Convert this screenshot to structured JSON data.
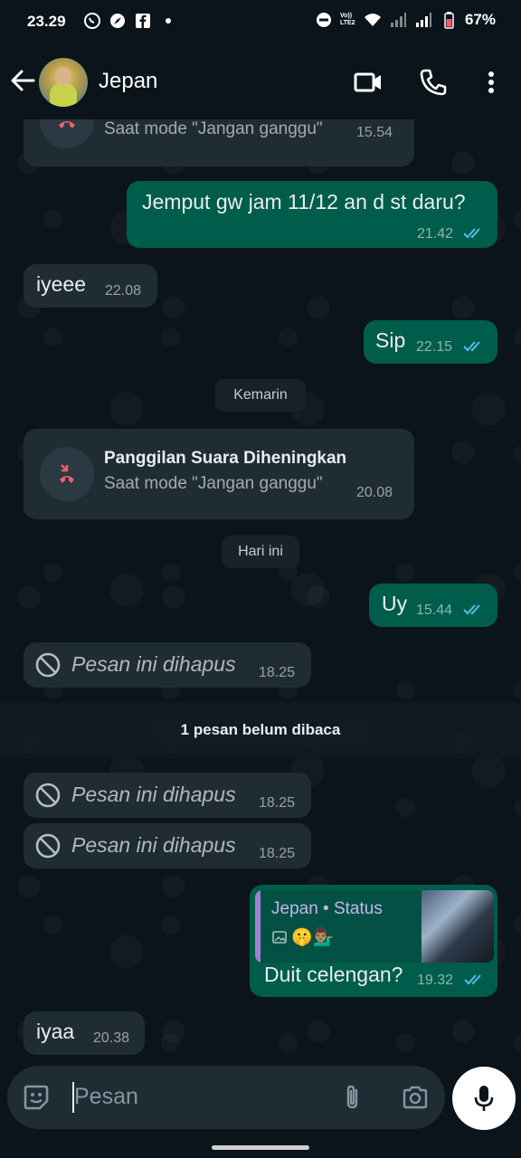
{
  "status_bar": {
    "time": "23.29",
    "network_label": "Vo)) LTE2",
    "battery": "67%"
  },
  "header": {
    "contact_name": "Jepan",
    "icons": [
      "back-arrow-icon",
      "video-call-icon",
      "voice-call-icon",
      "more-vert-icon"
    ]
  },
  "chat": {
    "top_call": {
      "subtitle": "Saat mode \"Jangan ganggu\"",
      "time": "15.54"
    },
    "messages": [
      {
        "dir": "out",
        "text": "Jemput gw jam 11/12 an d st daru?",
        "time": "21.42",
        "status": "read"
      },
      {
        "dir": "in",
        "text": "iyeee",
        "time": "22.08"
      },
      {
        "dir": "out",
        "text": "Sip",
        "time": "22.15",
        "status": "read"
      }
    ],
    "date_kemarin": "Kemarin",
    "silenced_call": {
      "title": "Panggilan Suara Diheningkan",
      "subtitle": "Saat mode \"Jangan ganggu\"",
      "time": "20.08"
    },
    "date_hari_ini": "Hari ini",
    "today_messages": [
      {
        "dir": "out",
        "text": "Uy",
        "time": "15.44",
        "status": "read"
      },
      {
        "dir": "in",
        "deleted": true,
        "text": "Pesan ini dihapus",
        "time": "18.25"
      }
    ],
    "unread_banner": "1 pesan belum dibaca",
    "after_unread": [
      {
        "dir": "in",
        "deleted": true,
        "text": "Pesan ini dihapus",
        "time": "18.25"
      },
      {
        "dir": "in",
        "deleted": true,
        "text": "Pesan ini dihapus",
        "time": "18.25"
      }
    ],
    "status_reply": {
      "quote_title": "Jepan • Status",
      "quote_emoji": "🤫💁🏽‍♂️",
      "text": "Duit celengan?",
      "time": "19.32",
      "status": "read"
    },
    "last_message": {
      "dir": "in",
      "text": "iyaa",
      "time": "20.38"
    }
  },
  "input": {
    "placeholder": "Pesan"
  },
  "colors": {
    "background": "#0b141a",
    "incoming_bubble": "#202c33",
    "outgoing_bubble": "#005c4b",
    "read_ticks": "#53bdeb",
    "missed_call_red": "#f15c6d"
  }
}
